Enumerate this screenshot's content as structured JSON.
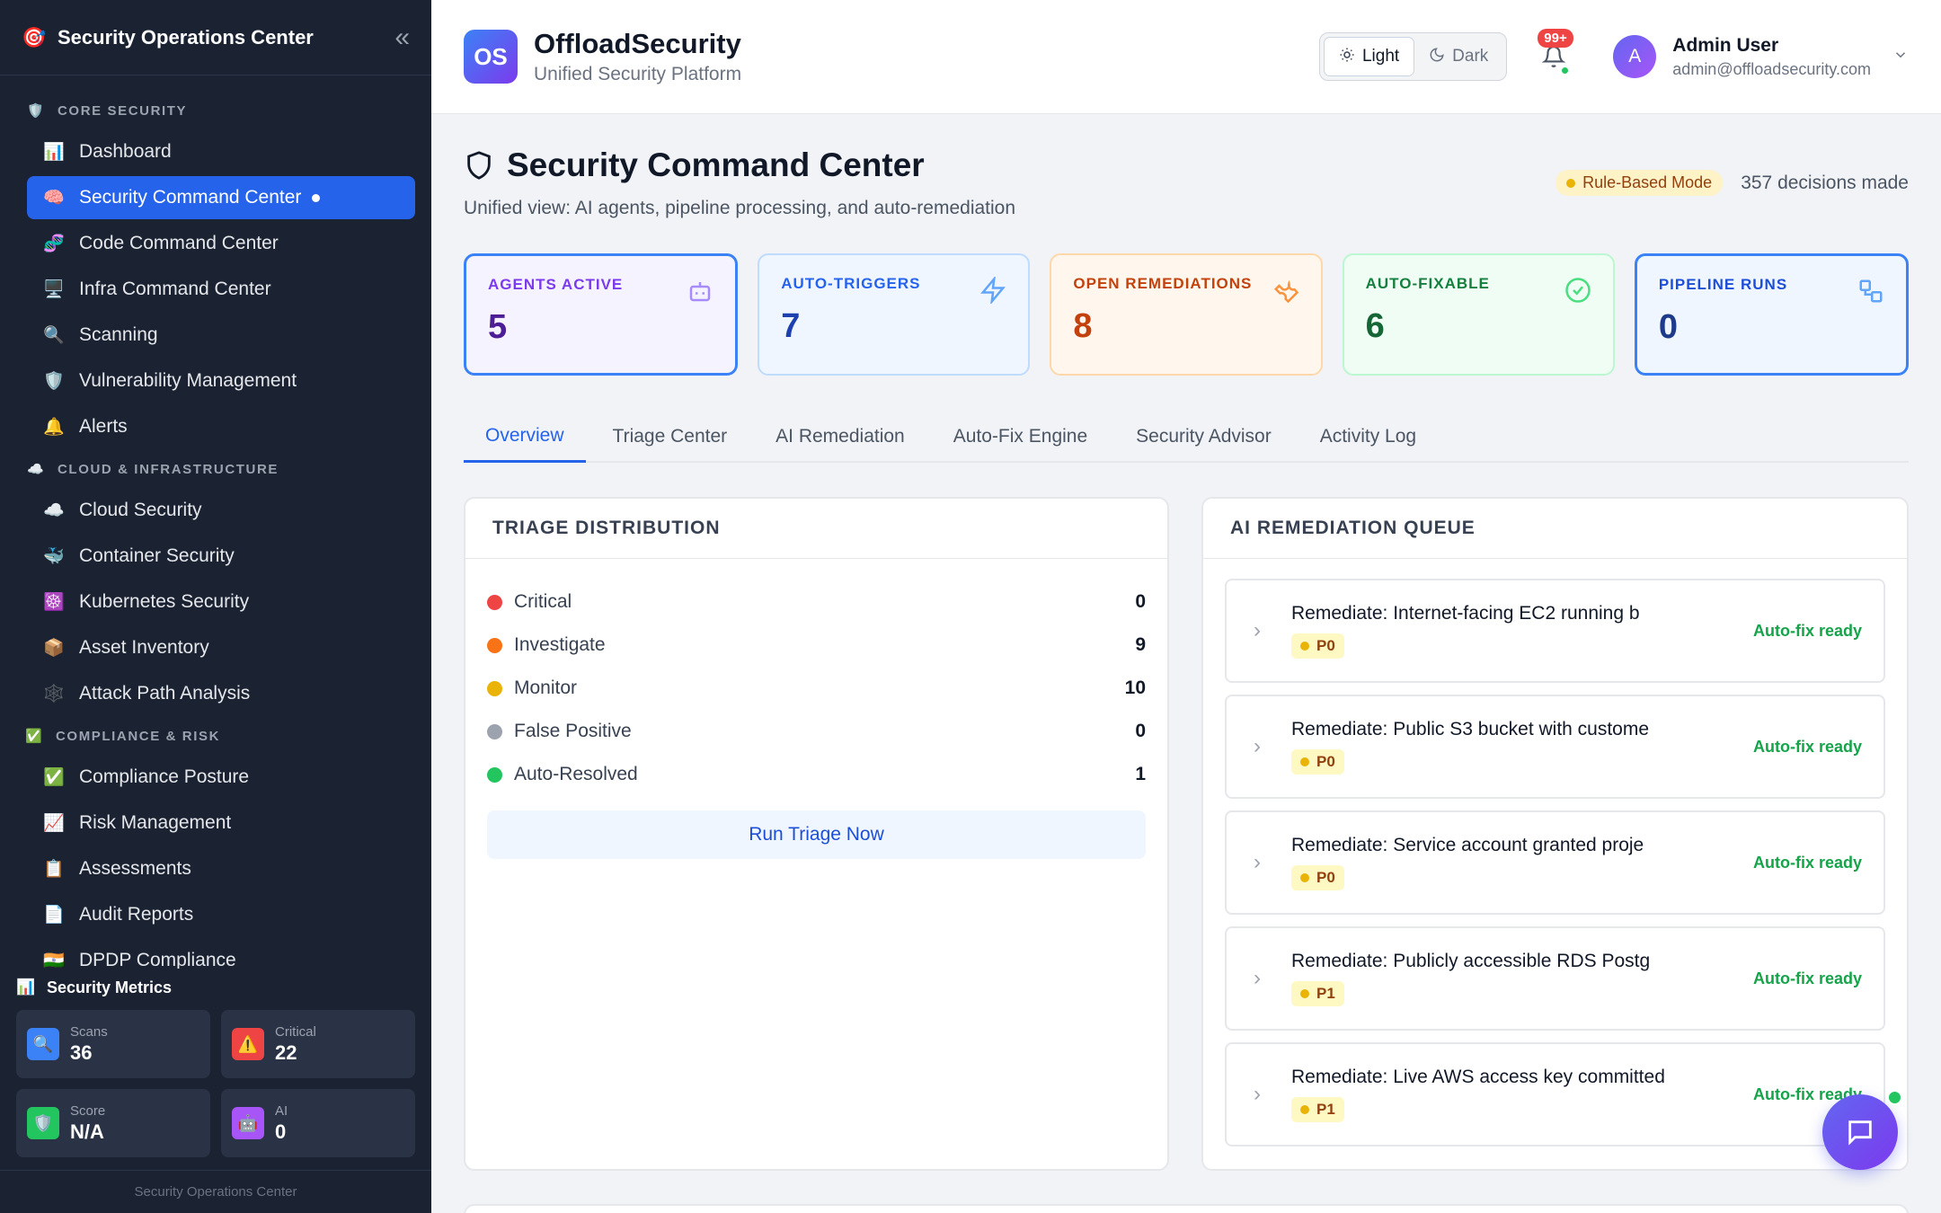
{
  "sidebar": {
    "title": "Security Operations Center",
    "logo_icon": "🎯",
    "collapse_icon": "«",
    "sections": [
      {
        "label": "CORE SECURITY",
        "icon": "🛡️"
      },
      {
        "label": "CLOUD & INFRASTRUCTURE",
        "icon": "☁️"
      },
      {
        "label": "COMPLIANCE & RISK",
        "icon": "✅"
      }
    ],
    "items": [
      {
        "label": "Dashboard",
        "icon": "📊"
      },
      {
        "label": "Security Command Center",
        "icon": "🧠"
      },
      {
        "label": "Code Command Center",
        "icon": "🧬"
      },
      {
        "label": "Infra Command Center",
        "icon": "🖥️"
      },
      {
        "label": "Scanning",
        "icon": "🔍"
      },
      {
        "label": "Vulnerability Management",
        "icon": "🛡️"
      },
      {
        "label": "Alerts",
        "icon": "🔔"
      },
      {
        "label": "Cloud Security",
        "icon": "☁️"
      },
      {
        "label": "Container Security",
        "icon": "🐳"
      },
      {
        "label": "Kubernetes Security",
        "icon": "☸️"
      },
      {
        "label": "Asset Inventory",
        "icon": "📦"
      },
      {
        "label": "Attack Path Analysis",
        "icon": "🕸️"
      },
      {
        "label": "Compliance Posture",
        "icon": "✅"
      },
      {
        "label": "Risk Management",
        "icon": "📈"
      },
      {
        "label": "Assessments",
        "icon": "📋"
      },
      {
        "label": "Audit Reports",
        "icon": "📄"
      },
      {
        "label": "DPDP Compliance",
        "icon": "🇮🇳"
      }
    ],
    "metrics_title": "Security Metrics",
    "metrics_icon": "📊",
    "metrics": [
      {
        "label": "Scans",
        "value": "36",
        "icon": "🔍",
        "color": "#3b82f6"
      },
      {
        "label": "Critical",
        "value": "22",
        "icon": "⚠️",
        "color": "#ef4444"
      },
      {
        "label": "Score",
        "value": "N/A",
        "icon": "🛡️",
        "color": "#22c55e"
      },
      {
        "label": "AI",
        "value": "0",
        "icon": "🤖",
        "color": "#a855f7"
      }
    ],
    "footer": "Security Operations Center"
  },
  "topbar": {
    "logo_text": "OS",
    "brand_name": "OffloadSecurity",
    "brand_sub": "Unified Security Platform",
    "theme_light": "Light",
    "theme_dark": "Dark",
    "notif_badge": "99+",
    "user_initial": "A",
    "user_name": "Admin User",
    "user_email": "admin@offloadsecurity.com"
  },
  "page": {
    "title": "Security Command Center",
    "subtitle": "Unified view: AI agents, pipeline processing, and auto-remediation",
    "mode": "Rule-Based Mode",
    "decisions": "357 decisions made"
  },
  "stats": [
    {
      "label": "AGENTS ACTIVE",
      "value": "5",
      "icon": "robot-icon"
    },
    {
      "label": "AUTO-TRIGGERS",
      "value": "7",
      "icon": "lightning-icon"
    },
    {
      "label": "OPEN REMEDIATIONS",
      "value": "8",
      "icon": "wrench-icon"
    },
    {
      "label": "AUTO-FIXABLE",
      "value": "6",
      "icon": "check-circle-icon"
    },
    {
      "label": "PIPELINE RUNS",
      "value": "0",
      "icon": "pipeline-icon"
    }
  ],
  "tabs": [
    "Overview",
    "Triage Center",
    "AI Remediation",
    "Auto-Fix Engine",
    "Security Advisor",
    "Activity Log"
  ],
  "triage": {
    "title": "TRIAGE DISTRIBUTION",
    "rows": [
      {
        "label": "Critical",
        "value": "0",
        "color": "#ef4444"
      },
      {
        "label": "Investigate",
        "value": "9",
        "color": "#f97316"
      },
      {
        "label": "Monitor",
        "value": "10",
        "color": "#eab308"
      },
      {
        "label": "False Positive",
        "value": "0",
        "color": "#9ca3af"
      },
      {
        "label": "Auto-Resolved",
        "value": "1",
        "color": "#22c55e"
      }
    ],
    "button": "Run Triage Now"
  },
  "queue": {
    "title": "AI REMEDIATION QUEUE",
    "items": [
      {
        "title": "Remediate: Internet-facing EC2 running b",
        "priority": "P0",
        "status": "Auto-fix ready"
      },
      {
        "title": "Remediate: Public S3 bucket with custome",
        "priority": "P0",
        "status": "Auto-fix ready"
      },
      {
        "title": "Remediate: Service account granted proje",
        "priority": "P0",
        "status": "Auto-fix ready"
      },
      {
        "title": "Remediate: Publicly accessible RDS Postg",
        "priority": "P1",
        "status": "Auto-fix ready"
      },
      {
        "title": "Remediate: Live AWS access key committed",
        "priority": "P1",
        "status": "Auto-fix ready"
      }
    ]
  }
}
